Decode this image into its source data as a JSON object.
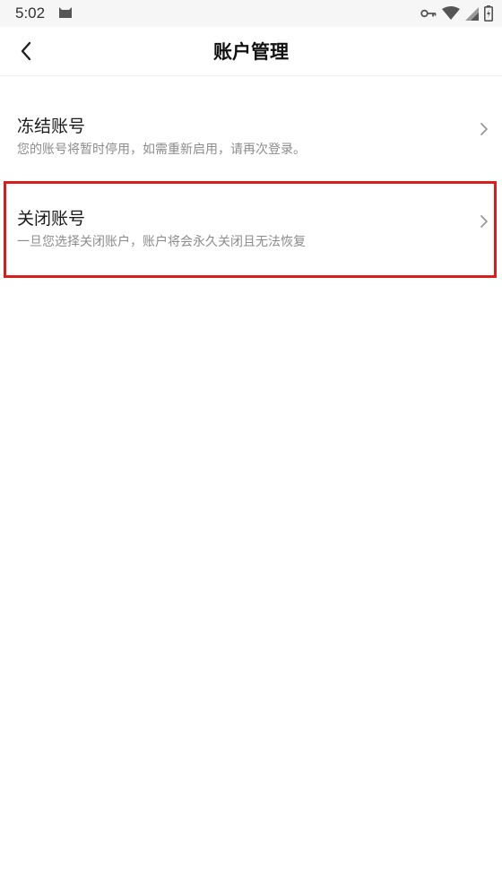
{
  "status_bar": {
    "time": "5:02",
    "icons": [
      "cat-notification-icon",
      "key-icon",
      "wifi-icon",
      "signal-icon",
      "battery-charging-icon"
    ]
  },
  "header": {
    "title": "账户管理",
    "back_icon": "chevron-left-icon"
  },
  "items": [
    {
      "title": "冻结账号",
      "description": "您的账号将暂时停用，如需重新启用，请再次登录。",
      "arrow_icon": "chevron-right-icon"
    },
    {
      "title": "关闭账号",
      "description": "一旦您选择关闭账户，账户将会永久关闭且无法恢复",
      "arrow_icon": "chevron-right-icon",
      "highlighted": true
    }
  ],
  "colors": {
    "highlight": "#d91c1c",
    "description_text": "#8c8c8c",
    "status_bar_bg": "#f6f6f6"
  }
}
